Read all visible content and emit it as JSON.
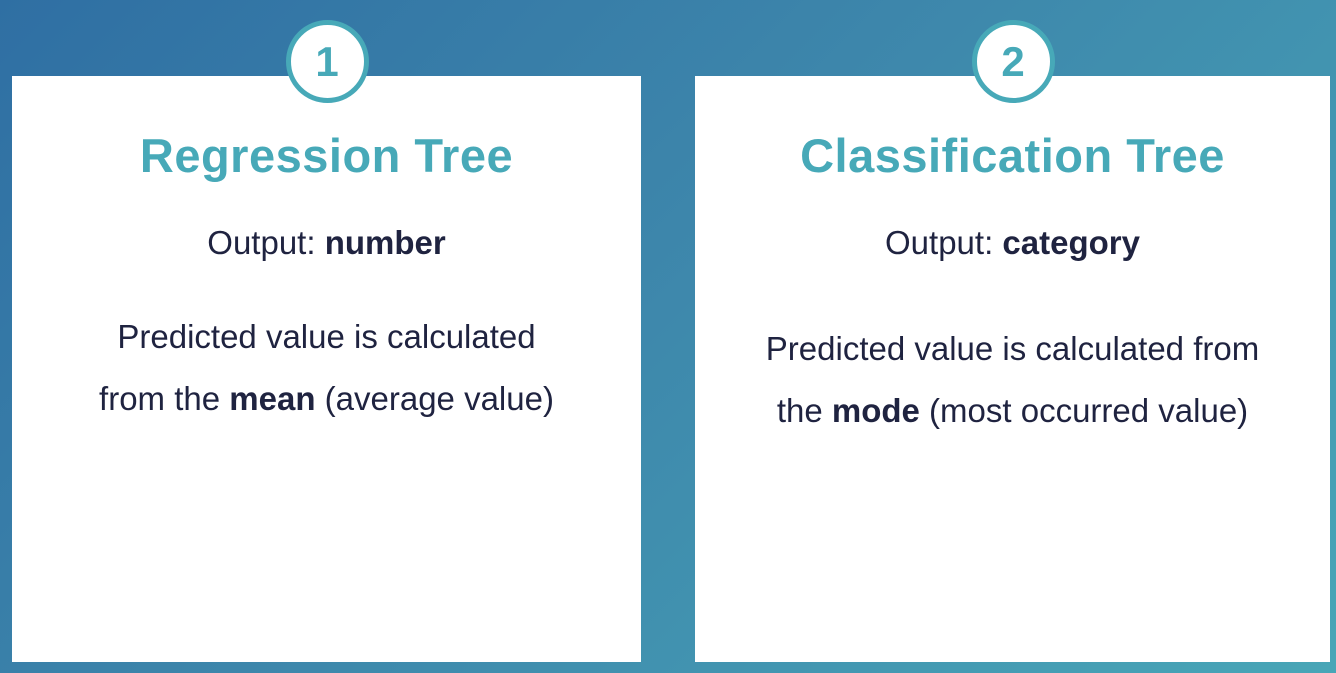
{
  "cards": [
    {
      "number": "1",
      "title": "Regression Tree",
      "output_prefix": "Output: ",
      "output_value": "number",
      "desc_line1": "Predicted value is calculated",
      "desc_line2_prefix": "from the ",
      "desc_line2_bold": "mean",
      "desc_line2_suffix": " (average value)"
    },
    {
      "number": "2",
      "title": "Classification Tree",
      "output_prefix": "Output: ",
      "output_value": "category",
      "desc_line1": "Predicted value is calculated from",
      "desc_line2_prefix": "the ",
      "desc_line2_bold": "mode",
      "desc_line2_suffix": " (most occurred value)"
    }
  ],
  "colors": {
    "accent": "#47a9b8",
    "text": "#1f2340",
    "background_start": "#2f6fa3",
    "background_end": "#48a6b7"
  }
}
